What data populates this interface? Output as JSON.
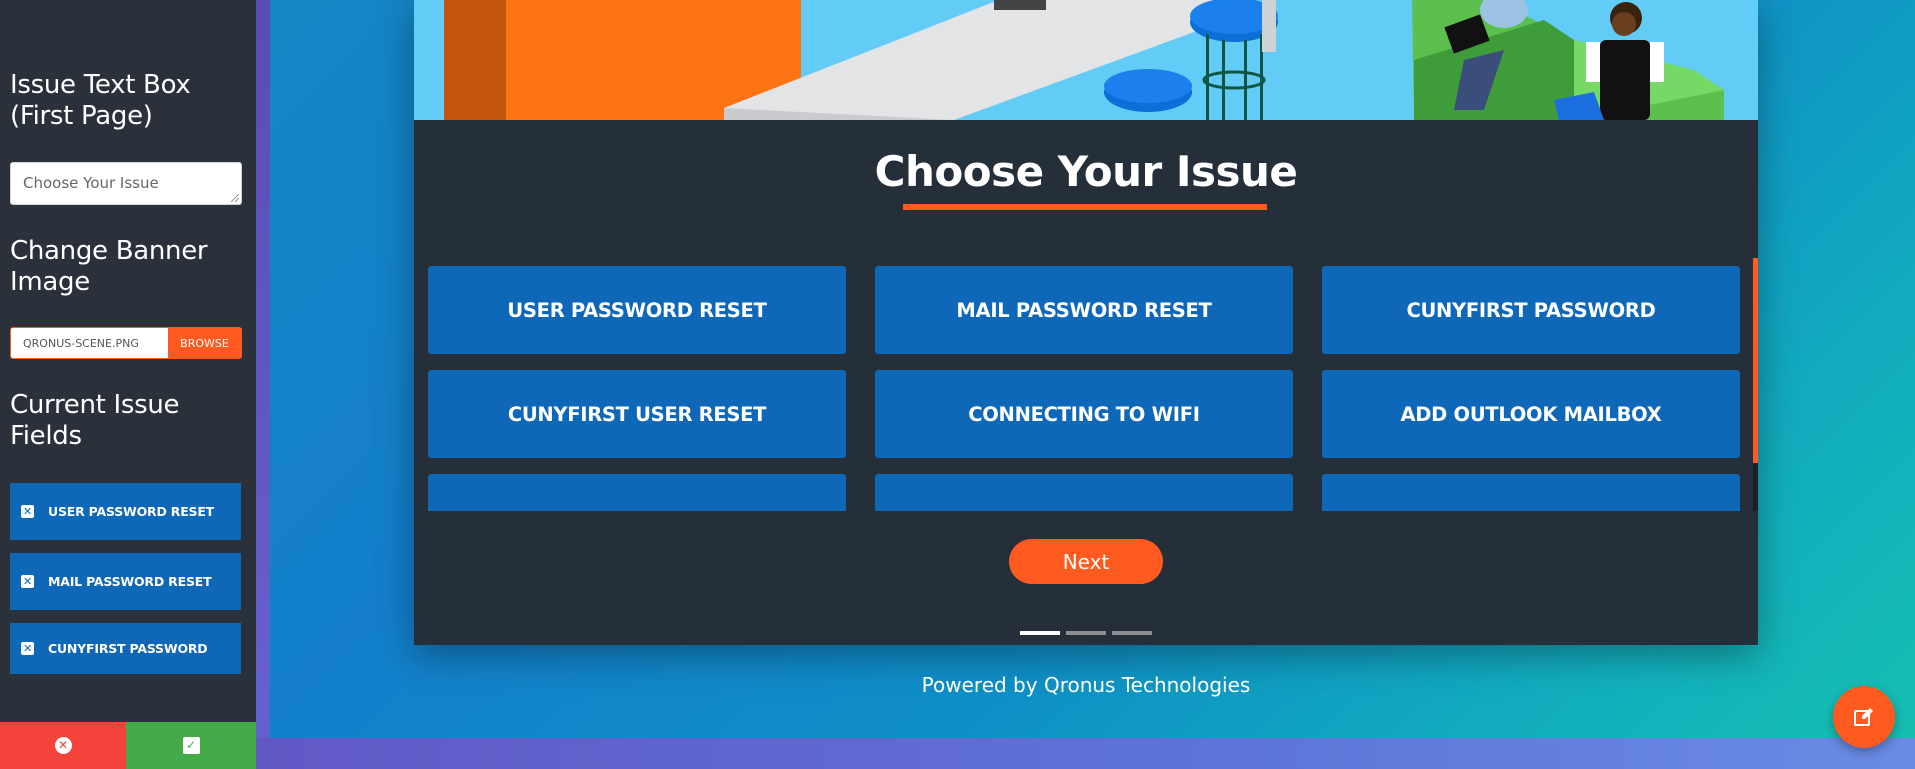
{
  "sidebar": {
    "issue_text_heading": "Issue Text Box (First Page)",
    "issue_text_value": "Choose Your Issue",
    "banner_heading": "Change Banner Image",
    "banner_file_name": "QRONUS-SCENE.PNG",
    "browse_label": "BROWSE",
    "fields_heading": "Current Issue Fields",
    "fields": [
      {
        "label": "USER PASSWORD RESET"
      },
      {
        "label": "MAIL PASSWORD RESET"
      },
      {
        "label": "CUNYFIRST PASSWORD"
      }
    ]
  },
  "card": {
    "title": "Choose Your Issue",
    "issues": [
      "USER PASSWORD RESET",
      "MAIL PASSWORD RESET",
      "CUNYFIRST PASSWORD",
      "CUNYFIRST USER RESET",
      "CONNECTING TO WIFI",
      "ADD OUTLOOK MAILBOX"
    ],
    "next_label": "Next",
    "pagination": {
      "count": 3,
      "active": 1
    }
  },
  "footer": {
    "powered_by": "Powered by Qronus Technologies"
  },
  "colors": {
    "accent": "#ff5a1f",
    "button_blue": "#0e67b7",
    "sidebar_bg": "#2a313b",
    "card_bg": "#252f3a",
    "cancel_red": "#f4433a",
    "save_green": "#45ab4a"
  },
  "icons": {
    "field_remove": "close-square-icon",
    "cancel": "close-circle-icon",
    "save": "check-square-icon",
    "fab": "edit-icon"
  }
}
